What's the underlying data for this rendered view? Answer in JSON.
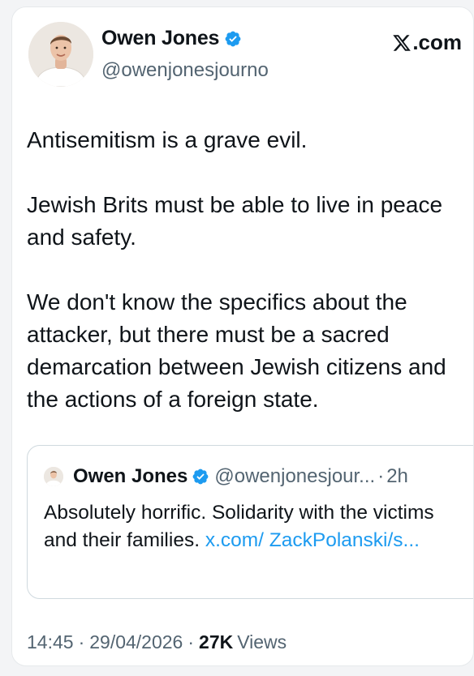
{
  "author": {
    "display_name": "Owen Jones",
    "handle": "@owenjonesjourno",
    "verified": true
  },
  "brand": {
    "label": ".com",
    "icon": "x-logo-icon"
  },
  "tweet": {
    "paragraphs": [
      "Antisemitism is a grave evil.",
      "Jewish Brits must be able to live in peace and safety.",
      "We don't know the specifics about the attacker, but there must be a sacred demarcation between Jewish citizens and the actions of a foreign state."
    ]
  },
  "quoted_tweet": {
    "display_name": "Owen Jones",
    "handle": "@owenjonesjour...",
    "separator": "·",
    "time": "2h",
    "text": "Absolutely horrific. Solidarity with the victims and their families. ",
    "link_text": "x.com/ ZackPolanski/s..."
  },
  "meta": {
    "time": "14:45",
    "date": "29/04/2026",
    "separator": "·",
    "views_count": "27K",
    "views_label": "Views"
  },
  "colors": {
    "verified_blue": "#1d9bf0",
    "link_blue": "#1d9bf0",
    "secondary_text": "#536471"
  }
}
